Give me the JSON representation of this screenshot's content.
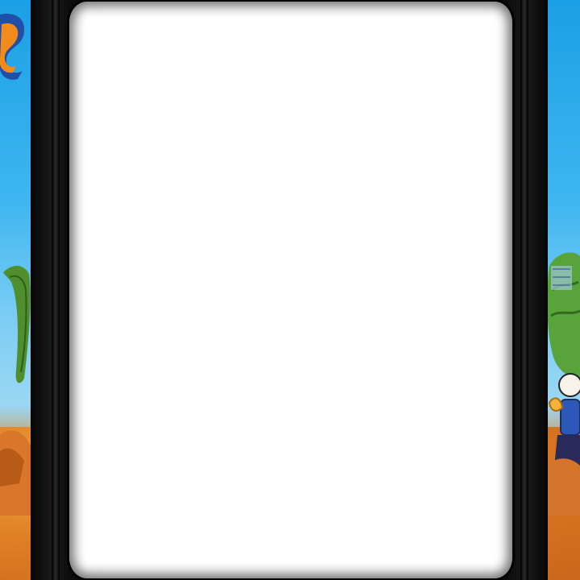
{
  "scene": {
    "background_color": "#1fa6e6",
    "ground_color": "#e07f25",
    "bezel_color": "#0d0d0d",
    "screen_color": "#ffffff"
  },
  "artwork": {
    "left": {
      "logo_letter": "S",
      "logo_colors": [
        "#1f4fa8",
        "#f28a1c"
      ],
      "creature": "green-dinosaur-tail"
    },
    "right": {
      "creature": "green-dinosaur",
      "character": "cartoon-duck"
    }
  }
}
